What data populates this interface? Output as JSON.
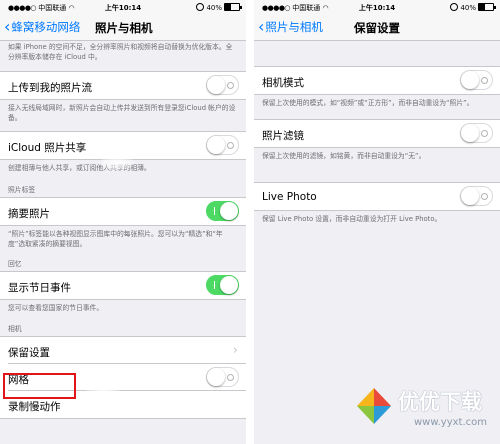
{
  "left": {
    "status": {
      "carrier": "中国联通",
      "time": "上午10:14",
      "battery": "40%"
    },
    "nav": {
      "back": "蜂窝移动网络",
      "title": "照片与相机"
    },
    "top_note": "如果 iPhone 的空间不足，全分辨率照片和视频将自动替换为优化版本。全分辨率版本储存在 iCloud 中。",
    "rows": {
      "photo_stream": "上传到我的照片流",
      "icloud_sharing": "iCloud 照片共享",
      "summary": "摘要照片",
      "holidays": "显示节日事件",
      "preserve": "保留设置",
      "grid": "网格",
      "slowmo": "录制慢动作"
    },
    "notes": {
      "photo_stream": "接入无线局域网时，新照片会自动上传并发送到所有登录您iCloud 帐户的设备。",
      "icloud_sharing": "创建相薄与他人共享，或订阅他人共享的相薄。",
      "summary": "“照片”标签能以各种视图显示图库中的每张照片。您可以为“精选”和“年度”选取紧凑的摘要视图。",
      "holidays": "您可以查看您国家的节日事件。"
    },
    "headers": {
      "photos_tab": "照片标签",
      "memories": "回忆",
      "camera": "相机"
    }
  },
  "right": {
    "status": {
      "carrier": "中国联通",
      "time": "上午10:14",
      "battery": "40%"
    },
    "nav": {
      "back": "照片与相机",
      "title": "保留设置"
    },
    "rows": {
      "camera_mode": "相机模式",
      "photo_filter": "照片滤镜",
      "live_photo": "Live Photo"
    },
    "notes": {
      "camera_mode": "保留上次使用的模式，如“视频”或“正方形”，而非自动重设为“照片”。",
      "photo_filter": "保留上次使用的滤镜，如铭黄，而非自动重设为“无”。",
      "live_photo": "保留 Live Photo 设置，而非自动重设为打开 Live Photo。"
    }
  },
  "watermark": {
    "title": "优优下载",
    "url": "www.yyxt.com"
  },
  "colors": {
    "accent": "#007aff",
    "switch_on": "#4cd964",
    "highlight": "#e0151b",
    "background": "#efeff4"
  },
  "toggles": {
    "photo_stream": false,
    "icloud_sharing": false,
    "summary": true,
    "holidays": true,
    "grid": false,
    "camera_mode": false,
    "photo_filter": false,
    "live_photo": false
  }
}
